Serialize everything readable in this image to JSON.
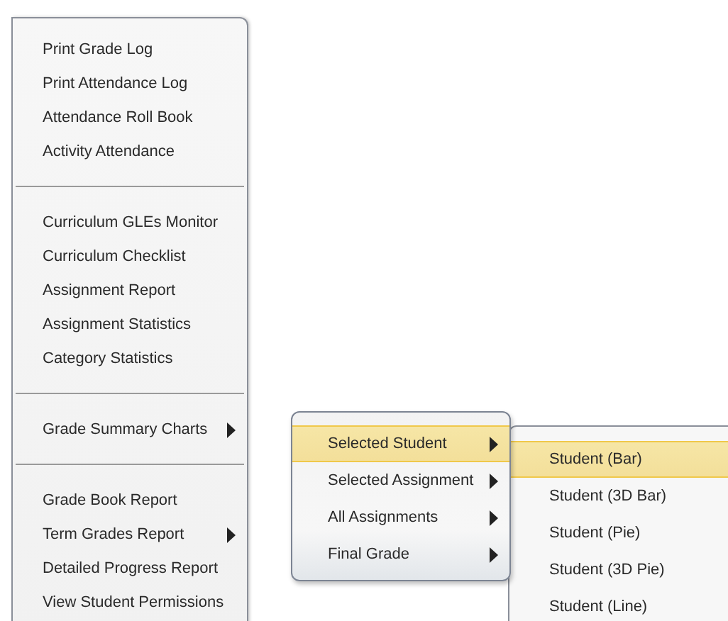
{
  "reports_menu": {
    "groups": [
      [
        {
          "label": "Print Grade Log",
          "submenu": false
        },
        {
          "label": "Print Attendance Log",
          "submenu": false
        },
        {
          "label": "Attendance Roll Book",
          "submenu": false
        },
        {
          "label": "Activity Attendance",
          "submenu": false
        }
      ],
      [
        {
          "label": "Curriculum GLEs Monitor",
          "submenu": false
        },
        {
          "label": "Curriculum Checklist",
          "submenu": false
        },
        {
          "label": "Assignment Report",
          "submenu": false
        },
        {
          "label": "Assignment Statistics",
          "submenu": false
        },
        {
          "label": "Category Statistics",
          "submenu": false
        }
      ],
      [
        {
          "label": "Grade Summary Charts",
          "submenu": true
        }
      ],
      [
        {
          "label": "Grade Book Report",
          "submenu": false
        },
        {
          "label": "Term Grades Report",
          "submenu": true
        },
        {
          "label": "Detailed Progress Report",
          "submenu": false
        },
        {
          "label": "View Student Permissions",
          "submenu": false
        }
      ]
    ]
  },
  "chart_scope_menu": {
    "items": [
      {
        "label": "Selected Student",
        "submenu": true,
        "selected": true
      },
      {
        "label": "Selected Assignment",
        "submenu": true,
        "selected": false
      },
      {
        "label": "All Assignments",
        "submenu": true,
        "selected": false
      },
      {
        "label": "Final Grade",
        "submenu": true,
        "selected": false
      }
    ]
  },
  "chart_type_menu": {
    "items": [
      {
        "label": "Student (Bar)",
        "selected": true
      },
      {
        "label": "Student (3D Bar)",
        "selected": false
      },
      {
        "label": "Student (Pie)",
        "selected": false
      },
      {
        "label": "Student (3D Pie)",
        "selected": false
      },
      {
        "label": "Student (Line)",
        "selected": false
      }
    ]
  }
}
